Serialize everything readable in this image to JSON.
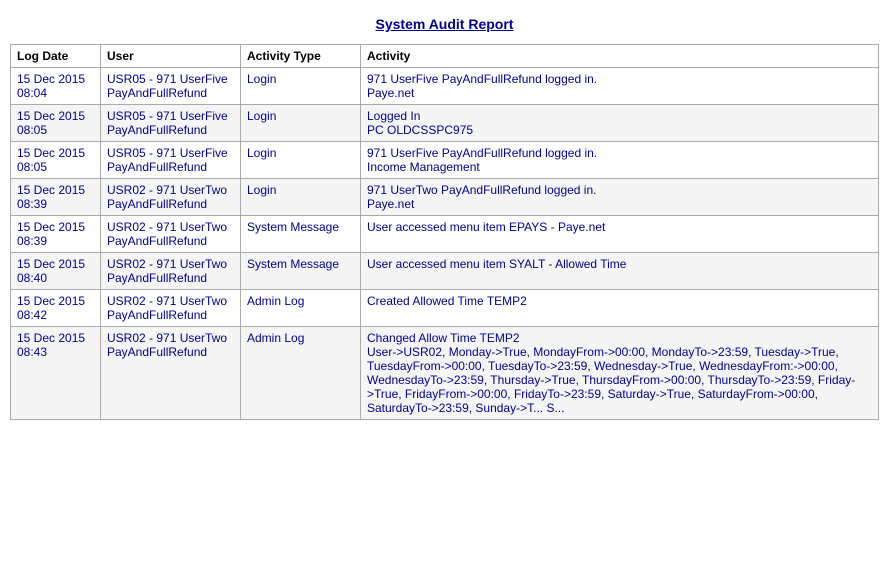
{
  "title": "System Audit Report",
  "table": {
    "headers": [
      "Log Date",
      "User",
      "Activity Type",
      "Activity"
    ],
    "rows": [
      {
        "date": "15 Dec 2015\n08:04",
        "user": "USR05 - 971 UserFive PayAndFullRefund",
        "type": "Login",
        "activity": "971 UserFive PayAndFullRefund logged in.\nPaye.net"
      },
      {
        "date": "15 Dec 2015\n08:05",
        "user": "USR05 - 971 UserFive PayAndFullRefund",
        "type": "Login",
        "activity": "Logged In\nPC OLDCSSPC975"
      },
      {
        "date": "15 Dec 2015\n08:05",
        "user": "USR05 - 971 UserFive PayAndFullRefund",
        "type": "Login",
        "activity": "971 UserFive PayAndFullRefund logged in.\nIncome Management"
      },
      {
        "date": "15 Dec 2015\n08:39",
        "user": "USR02 - 971 UserTwo PayAndFullRefund",
        "type": "Login",
        "activity": "971 UserTwo PayAndFullRefund logged in.\nPaye.net"
      },
      {
        "date": "15 Dec 2015\n08:39",
        "user": "USR02 - 971 UserTwo PayAndFullRefund",
        "type": "System Message",
        "activity": "User accessed menu item EPAYS - Paye.net"
      },
      {
        "date": "15 Dec 2015\n08:40",
        "user": "USR02 - 971 UserTwo PayAndFullRefund",
        "type": "System Message",
        "activity": "User accessed menu item SYALT - Allowed Time"
      },
      {
        "date": "15 Dec 2015\n08:42",
        "user": "USR02 - 971 UserTwo PayAndFullRefund",
        "type": "Admin Log",
        "activity": "Created Allowed Time TEMP2"
      },
      {
        "date": "15 Dec 2015\n08:43",
        "user": "USR02 - 971 UserTwo PayAndFullRefund",
        "type": "Admin Log",
        "activity": "Changed Allow Time TEMP2\nUser->USR02, Monday->True, MondayFrom->00:00, MondayTo->23:59, Tuesday->True, TuesdayFrom->00:00, TuesdayTo->23:59, Wednesday->True, WednesdayFrom:->00:00, WednesdayTo->23:59, Thursday->True, ThursdayFrom->00:00, ThursdayTo->23:59, Friday->True, FridayFrom->00:00, FridayTo->23:59, Saturday->True, SaturdayFrom->00:00, SaturdayTo->23:59, Sunday->T... S..."
      }
    ]
  }
}
